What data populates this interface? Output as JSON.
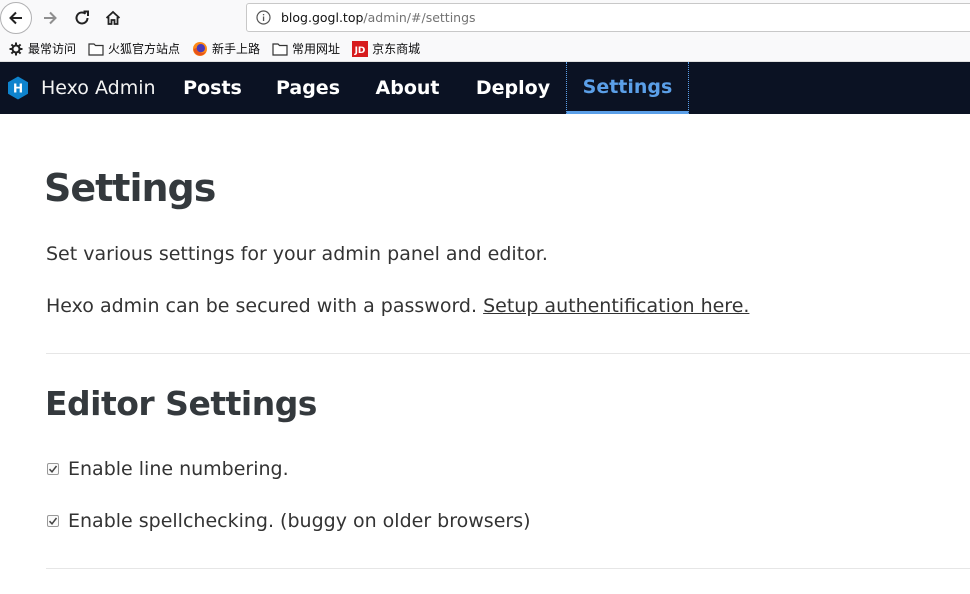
{
  "browser": {
    "url_host": "blog.gogl.top",
    "url_path": "/admin/#/settings"
  },
  "bookmarks": [
    {
      "label": "最常访问",
      "icon": "gear-icon"
    },
    {
      "label": "火狐官方站点",
      "icon": "folder-icon"
    },
    {
      "label": "新手上路",
      "icon": "firefox-icon"
    },
    {
      "label": "常用网址",
      "icon": "folder-icon"
    },
    {
      "label": "京东商城",
      "icon": "jd-icon"
    }
  ],
  "nav": {
    "brand": "Hexo Admin",
    "logo_letter": "H",
    "items": [
      "Posts",
      "Pages",
      "About",
      "Deploy",
      "Settings"
    ],
    "active": "Settings",
    "active_color": "#5b9fe8",
    "bg_color": "#0b1223"
  },
  "content": {
    "title": "Settings",
    "intro": "Set various settings for your admin panel and editor.",
    "password_text": "Hexo admin can be secured with a password.",
    "password_link": "Setup authentification here.",
    "editor_title": "Editor Settings",
    "options": [
      {
        "label": "Enable line numbering.",
        "checked": true
      },
      {
        "label": "Enable spellchecking. (buggy on older browsers)",
        "checked": true
      }
    ]
  }
}
